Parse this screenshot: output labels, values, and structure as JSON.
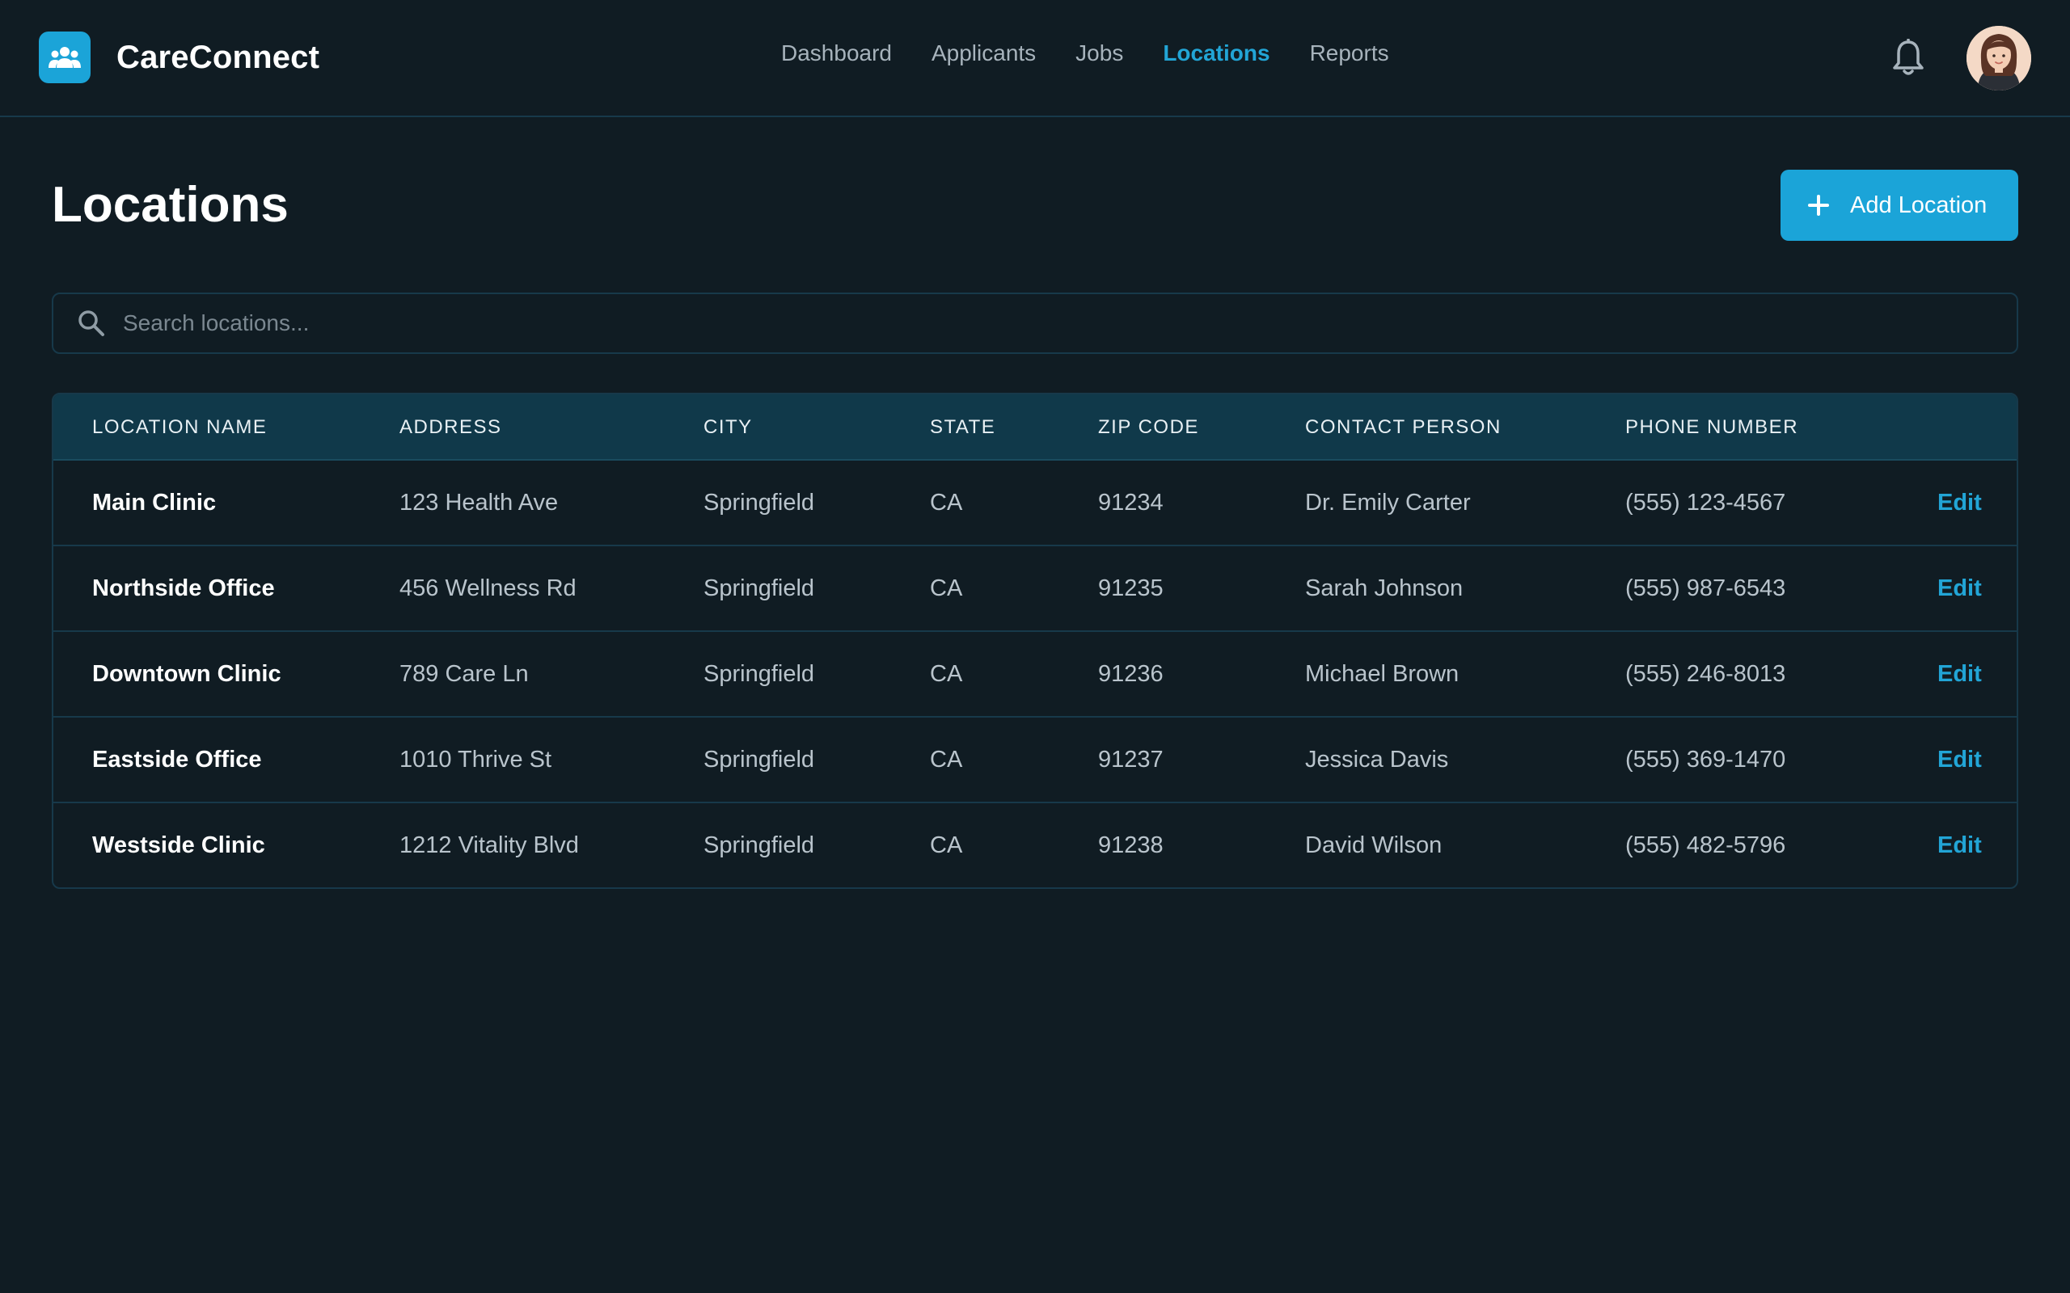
{
  "app": {
    "name": "CareConnect",
    "logo_icon": "users-group-icon"
  },
  "nav": {
    "items": [
      {
        "label": "Dashboard",
        "active": false
      },
      {
        "label": "Applicants",
        "active": false
      },
      {
        "label": "Jobs",
        "active": false
      },
      {
        "label": "Locations",
        "active": true
      },
      {
        "label": "Reports",
        "active": false
      }
    ]
  },
  "header_actions": {
    "notifications_icon": "bell-icon",
    "avatar": "user-avatar"
  },
  "page": {
    "title": "Locations",
    "add_button_label": "Add Location"
  },
  "search": {
    "placeholder": "Search locations...",
    "value": ""
  },
  "table": {
    "columns": [
      "LOCATION NAME",
      "ADDRESS",
      "CITY",
      "STATE",
      "ZIP CODE",
      "CONTACT PERSON",
      "PHONE NUMBER"
    ],
    "action_label": "Edit",
    "rows": [
      {
        "name": "Main Clinic",
        "address": "123 Health Ave",
        "city": "Springfield",
        "state": "CA",
        "zip": "91234",
        "contact": "Dr. Emily Carter",
        "phone": "(555) 123-4567"
      },
      {
        "name": "Northside Office",
        "address": "456 Wellness Rd",
        "city": "Springfield",
        "state": "CA",
        "zip": "91235",
        "contact": "Sarah Johnson",
        "phone": "(555) 987-6543"
      },
      {
        "name": "Downtown Clinic",
        "address": "789 Care Ln",
        "city": "Springfield",
        "state": "CA",
        "zip": "91236",
        "contact": "Michael Brown",
        "phone": "(555) 246-8013"
      },
      {
        "name": "Eastside Office",
        "address": "1010 Thrive St",
        "city": "Springfield",
        "state": "CA",
        "zip": "91237",
        "contact": "Jessica Davis",
        "phone": "(555) 369-1470"
      },
      {
        "name": "Westside Clinic",
        "address": "1212 Vitality Blvd",
        "city": "Springfield",
        "state": "CA",
        "zip": "91238",
        "contact": "David Wilson",
        "phone": "(555) 482-5796"
      }
    ]
  },
  "colors": {
    "background": "#101c23",
    "accent": "#1ba4d8",
    "border": "#17394a",
    "table_header": "#10394a"
  }
}
